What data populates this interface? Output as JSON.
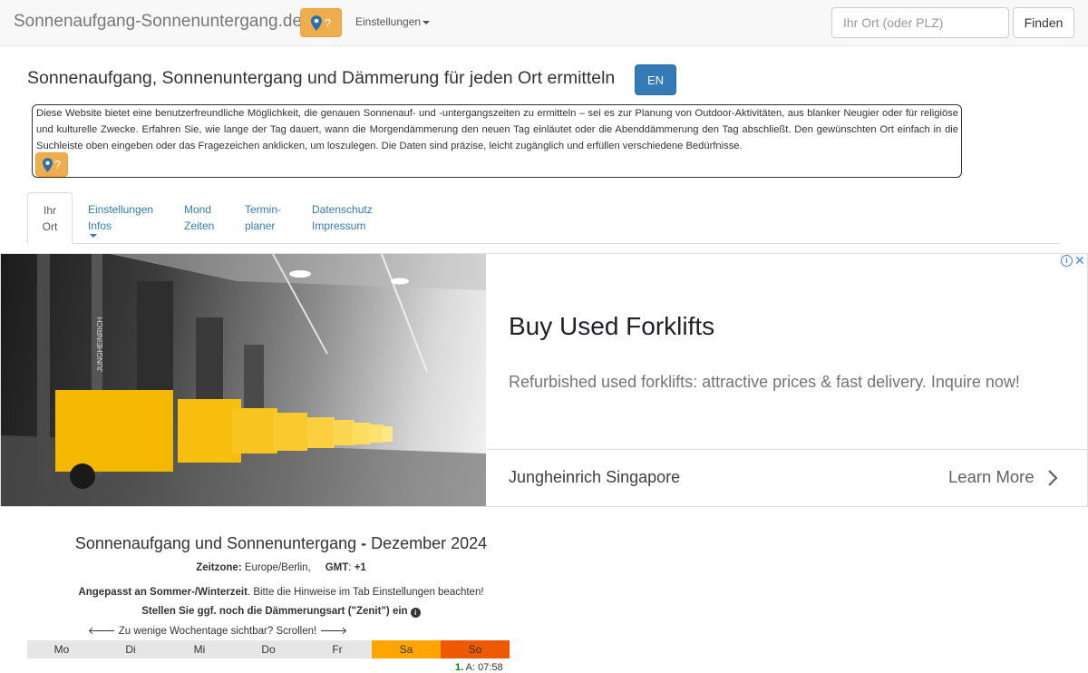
{
  "navbar": {
    "brand": "Sonnenaufgang-Sonnenuntergang.de",
    "help_label": "?",
    "settings_label": "Einstellungen",
    "search_placeholder": "Ihr Ort (oder PLZ)",
    "find_label": "Finden"
  },
  "header": {
    "title": "Sonnenaufgang, Sonnenuntergang und Dämmerung für jeden Ort ermitteln",
    "lang_button": "EN"
  },
  "intro": {
    "text": "Diese Website bietet eine benutzerfreundliche Möglichkeit, die genauen Sonnenauf- und -untergangszeiten zu ermitteln – sei es zur Planung von Outdoor-Aktivitäten, aus blanker Neugier oder für religiöse und kulturelle Zwecke. Erfahren Sie, wie lange der Tag dauert, wann die Morgendämmerung den neuen Tag einläutet oder die Abenddämmerung den Tag abschließt. Den gewünschten Ort einfach in die Suchleiste oben eingeben oder das Fragezeichen anklicken, um loszulegen. Die Daten sind präzise, leicht zugänglich und erfüllen verschiedene Bedürfnisse.",
    "help_label": "?"
  },
  "tabs": [
    {
      "line1": "Ihr",
      "line2": "Ort"
    },
    {
      "line1": "Einstellungen",
      "line2": "Infos"
    },
    {
      "line1": "Mond",
      "line2": "Zeiten"
    },
    {
      "line1": "Termin-",
      "line2": "planer"
    },
    {
      "line1": "Datenschutz",
      "line2": "Impressum"
    }
  ],
  "ad": {
    "title": "Buy Used Forklifts",
    "description": "Refurbished used forklifts: attractive prices & fast delivery. Inquire now!",
    "advertiser": "Jungheinrich Singapore",
    "cta": "Learn More",
    "image_brand": "JUNGHEINRICH"
  },
  "calendar": {
    "title_main": "Sonnenaufgang und Sonnenuntergang",
    "title_sep": " - ",
    "title_month": "Dezember 2024",
    "tz_label": "Zeitzone:",
    "tz_value": "Europe/Berlin,",
    "gmt_label": "GMT",
    "gmt_value": "+1",
    "note_bold": "Angepasst an Sommer-/Winterzeit",
    "note_rest": ". Bitte die Hinweise im Tab Einstellungen beachten!",
    "zenith_note": "Stellen Sie ggf. noch die Dämmerungsart (\"Zenit\") ein",
    "scroll_hint": "Zu wenige Wochentage sichtbar? Scrollen!",
    "weekdays": [
      "Mo",
      "Di",
      "Mi",
      "Do",
      "Fr",
      "Sa",
      "So"
    ],
    "first_day_num": "1.",
    "first_day_text": "A: 07:58"
  },
  "colors": {
    "help_button": "#f0ad4e",
    "lang_button": "#337ab7",
    "saturday": "#ffa500",
    "sunday": "#ef5a00",
    "weekday": "#e6e6e6"
  }
}
